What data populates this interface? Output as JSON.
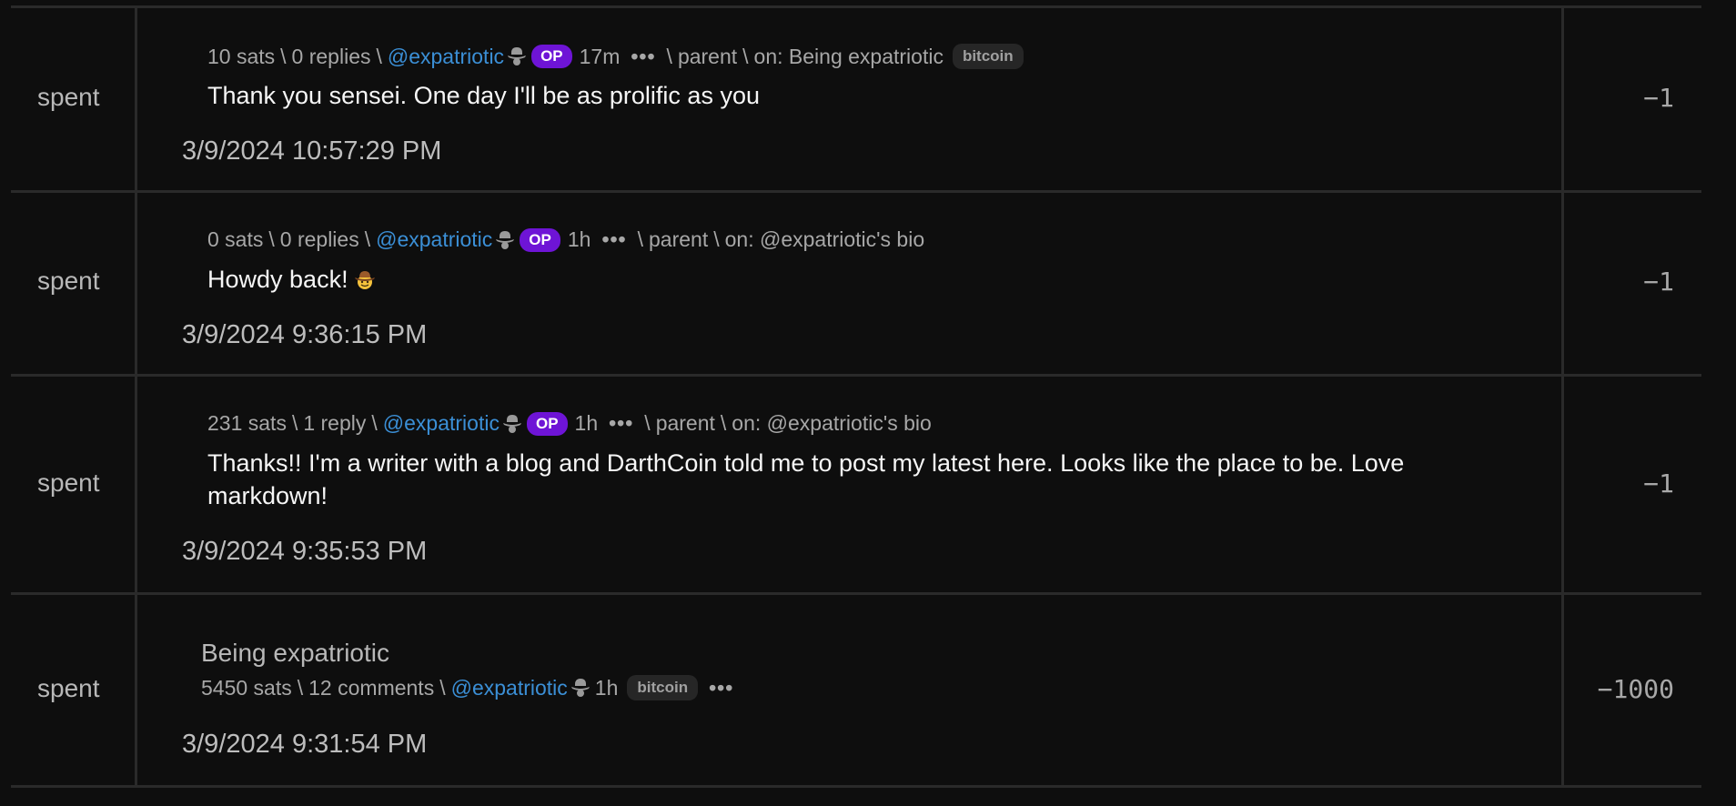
{
  "rows": [
    {
      "type": "spent",
      "meta": {
        "sats": "10 sats",
        "replies": "0 replies",
        "user": "@expatriotic",
        "op": "OP",
        "age": "17m",
        "parent": "parent",
        "on": "on: Being expatriotic",
        "tag": "bitcoin"
      },
      "text": "Thank you sensei. One day I'll be as prolific as you",
      "timestamp": "3/9/2024 10:57:29 PM",
      "amount": "−1"
    },
    {
      "type": "spent",
      "meta": {
        "sats": "0 sats",
        "replies": "0 replies",
        "user": "@expatriotic",
        "op": "OP",
        "age": "1h",
        "parent": "parent",
        "on": "on: @expatriotic's bio"
      },
      "text": "Howdy back!",
      "emoji": "cowboy-face-emoji",
      "timestamp": "3/9/2024 9:36:15 PM",
      "amount": "−1"
    },
    {
      "type": "spent",
      "meta": {
        "sats": "231 sats",
        "replies": "1 reply",
        "user": "@expatriotic",
        "op": "OP",
        "age": "1h",
        "parent": "parent",
        "on": "on: @expatriotic's bio"
      },
      "text": "Thanks!! I'm a writer with a blog and DarthCoin told me to post my latest here. Looks like the place to be. Love markdown!",
      "timestamp": "3/9/2024 9:35:53 PM",
      "amount": "−1"
    },
    {
      "type": "spent",
      "title": "Being expatriotic",
      "meta": {
        "sats": "5450 sats",
        "comments": "12 comments",
        "user": "@expatriotic",
        "age": "1h",
        "tag": "bitcoin"
      },
      "timestamp": "3/9/2024 9:31:54 PM",
      "amount": "−1000"
    }
  ],
  "colors": {
    "background": "#0e0e0e",
    "link": "#3b8fd6",
    "op_badge": "#6e14d6",
    "divider": "#2a2a2a"
  },
  "icons": {
    "hat": "cowboy-hat-icon",
    "more": "more-options-icon"
  }
}
